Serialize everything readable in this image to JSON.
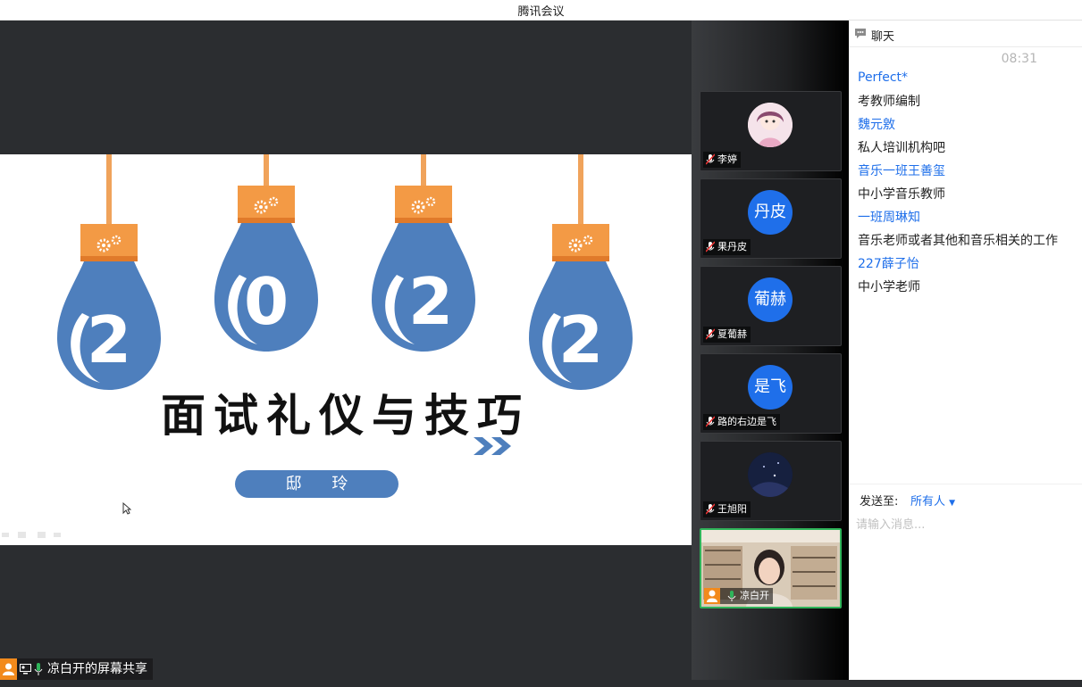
{
  "app": {
    "title": "腾讯会议"
  },
  "slide": {
    "bulb_digits": [
      "2",
      "0",
      "2",
      "2"
    ],
    "title": "面试礼仪与技巧",
    "presenter": "邸 玲",
    "colors": {
      "bulb_blue": "#4e7fbd",
      "cap_orange": "#f39a45",
      "cord": "#f0a35b"
    }
  },
  "participants": [
    {
      "name": "李婷",
      "avatar_text": "",
      "avatar_kind": "photo-cartoon",
      "mic": "muted"
    },
    {
      "name": "果丹皮",
      "avatar_text": "丹皮",
      "avatar_kind": "initials",
      "mic": "muted"
    },
    {
      "name": "夏葡赫",
      "avatar_text": "葡赫",
      "avatar_kind": "initials",
      "mic": "muted"
    },
    {
      "name": "路的右边是飞",
      "avatar_text": "是飞",
      "avatar_kind": "initials",
      "mic": "muted"
    },
    {
      "name": "王旭阳",
      "avatar_text": "",
      "avatar_kind": "photo-night",
      "mic": "muted"
    },
    {
      "name": "凉白开",
      "avatar_text": "",
      "avatar_kind": "video",
      "mic": "on",
      "active": true
    }
  ],
  "chat": {
    "header": "聊天",
    "time": "08:31",
    "messages": [
      {
        "sender": "Perfect*",
        "text": "考教师编制"
      },
      {
        "sender": "魏元敫",
        "text": "私人培训机构吧"
      },
      {
        "sender": "音乐一班王善玺",
        "text": "中小学音乐教师"
      },
      {
        "sender": "一班周琳知",
        "text": "音乐老师或者其他和音乐相关的工作"
      },
      {
        "sender": "227薛子怡",
        "text": "中小学老师"
      }
    ],
    "send_to_label": "发送至:",
    "send_to_value": "所有人",
    "input_placeholder": "请输入消息..."
  },
  "share_bar": {
    "label": "凉白开的屏幕共享"
  },
  "colors": {
    "accent": "#1f6fea",
    "active_border": "#2fb45a",
    "user_orange": "#f28a1c"
  }
}
